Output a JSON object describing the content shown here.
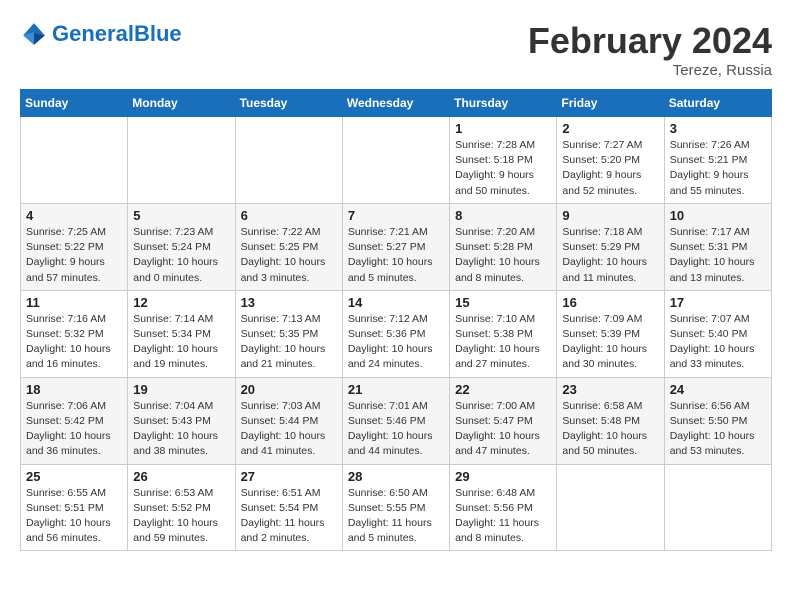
{
  "header": {
    "logo_general": "General",
    "logo_blue": "Blue",
    "month_year": "February 2024",
    "location": "Tereze, Russia"
  },
  "weekdays": [
    "Sunday",
    "Monday",
    "Tuesday",
    "Wednesday",
    "Thursday",
    "Friday",
    "Saturday"
  ],
  "weeks": [
    [
      {
        "day": "",
        "info": ""
      },
      {
        "day": "",
        "info": ""
      },
      {
        "day": "",
        "info": ""
      },
      {
        "day": "",
        "info": ""
      },
      {
        "day": "1",
        "info": "Sunrise: 7:28 AM\nSunset: 5:18 PM\nDaylight: 9 hours\nand 50 minutes."
      },
      {
        "day": "2",
        "info": "Sunrise: 7:27 AM\nSunset: 5:20 PM\nDaylight: 9 hours\nand 52 minutes."
      },
      {
        "day": "3",
        "info": "Sunrise: 7:26 AM\nSunset: 5:21 PM\nDaylight: 9 hours\nand 55 minutes."
      }
    ],
    [
      {
        "day": "4",
        "info": "Sunrise: 7:25 AM\nSunset: 5:22 PM\nDaylight: 9 hours\nand 57 minutes."
      },
      {
        "day": "5",
        "info": "Sunrise: 7:23 AM\nSunset: 5:24 PM\nDaylight: 10 hours\nand 0 minutes."
      },
      {
        "day": "6",
        "info": "Sunrise: 7:22 AM\nSunset: 5:25 PM\nDaylight: 10 hours\nand 3 minutes."
      },
      {
        "day": "7",
        "info": "Sunrise: 7:21 AM\nSunset: 5:27 PM\nDaylight: 10 hours\nand 5 minutes."
      },
      {
        "day": "8",
        "info": "Sunrise: 7:20 AM\nSunset: 5:28 PM\nDaylight: 10 hours\nand 8 minutes."
      },
      {
        "day": "9",
        "info": "Sunrise: 7:18 AM\nSunset: 5:29 PM\nDaylight: 10 hours\nand 11 minutes."
      },
      {
        "day": "10",
        "info": "Sunrise: 7:17 AM\nSunset: 5:31 PM\nDaylight: 10 hours\nand 13 minutes."
      }
    ],
    [
      {
        "day": "11",
        "info": "Sunrise: 7:16 AM\nSunset: 5:32 PM\nDaylight: 10 hours\nand 16 minutes."
      },
      {
        "day": "12",
        "info": "Sunrise: 7:14 AM\nSunset: 5:34 PM\nDaylight: 10 hours\nand 19 minutes."
      },
      {
        "day": "13",
        "info": "Sunrise: 7:13 AM\nSunset: 5:35 PM\nDaylight: 10 hours\nand 21 minutes."
      },
      {
        "day": "14",
        "info": "Sunrise: 7:12 AM\nSunset: 5:36 PM\nDaylight: 10 hours\nand 24 minutes."
      },
      {
        "day": "15",
        "info": "Sunrise: 7:10 AM\nSunset: 5:38 PM\nDaylight: 10 hours\nand 27 minutes."
      },
      {
        "day": "16",
        "info": "Sunrise: 7:09 AM\nSunset: 5:39 PM\nDaylight: 10 hours\nand 30 minutes."
      },
      {
        "day": "17",
        "info": "Sunrise: 7:07 AM\nSunset: 5:40 PM\nDaylight: 10 hours\nand 33 minutes."
      }
    ],
    [
      {
        "day": "18",
        "info": "Sunrise: 7:06 AM\nSunset: 5:42 PM\nDaylight: 10 hours\nand 36 minutes."
      },
      {
        "day": "19",
        "info": "Sunrise: 7:04 AM\nSunset: 5:43 PM\nDaylight: 10 hours\nand 38 minutes."
      },
      {
        "day": "20",
        "info": "Sunrise: 7:03 AM\nSunset: 5:44 PM\nDaylight: 10 hours\nand 41 minutes."
      },
      {
        "day": "21",
        "info": "Sunrise: 7:01 AM\nSunset: 5:46 PM\nDaylight: 10 hours\nand 44 minutes."
      },
      {
        "day": "22",
        "info": "Sunrise: 7:00 AM\nSunset: 5:47 PM\nDaylight: 10 hours\nand 47 minutes."
      },
      {
        "day": "23",
        "info": "Sunrise: 6:58 AM\nSunset: 5:48 PM\nDaylight: 10 hours\nand 50 minutes."
      },
      {
        "day": "24",
        "info": "Sunrise: 6:56 AM\nSunset: 5:50 PM\nDaylight: 10 hours\nand 53 minutes."
      }
    ],
    [
      {
        "day": "25",
        "info": "Sunrise: 6:55 AM\nSunset: 5:51 PM\nDaylight: 10 hours\nand 56 minutes."
      },
      {
        "day": "26",
        "info": "Sunrise: 6:53 AM\nSunset: 5:52 PM\nDaylight: 10 hours\nand 59 minutes."
      },
      {
        "day": "27",
        "info": "Sunrise: 6:51 AM\nSunset: 5:54 PM\nDaylight: 11 hours\nand 2 minutes."
      },
      {
        "day": "28",
        "info": "Sunrise: 6:50 AM\nSunset: 5:55 PM\nDaylight: 11 hours\nand 5 minutes."
      },
      {
        "day": "29",
        "info": "Sunrise: 6:48 AM\nSunset: 5:56 PM\nDaylight: 11 hours\nand 8 minutes."
      },
      {
        "day": "",
        "info": ""
      },
      {
        "day": "",
        "info": ""
      }
    ]
  ]
}
